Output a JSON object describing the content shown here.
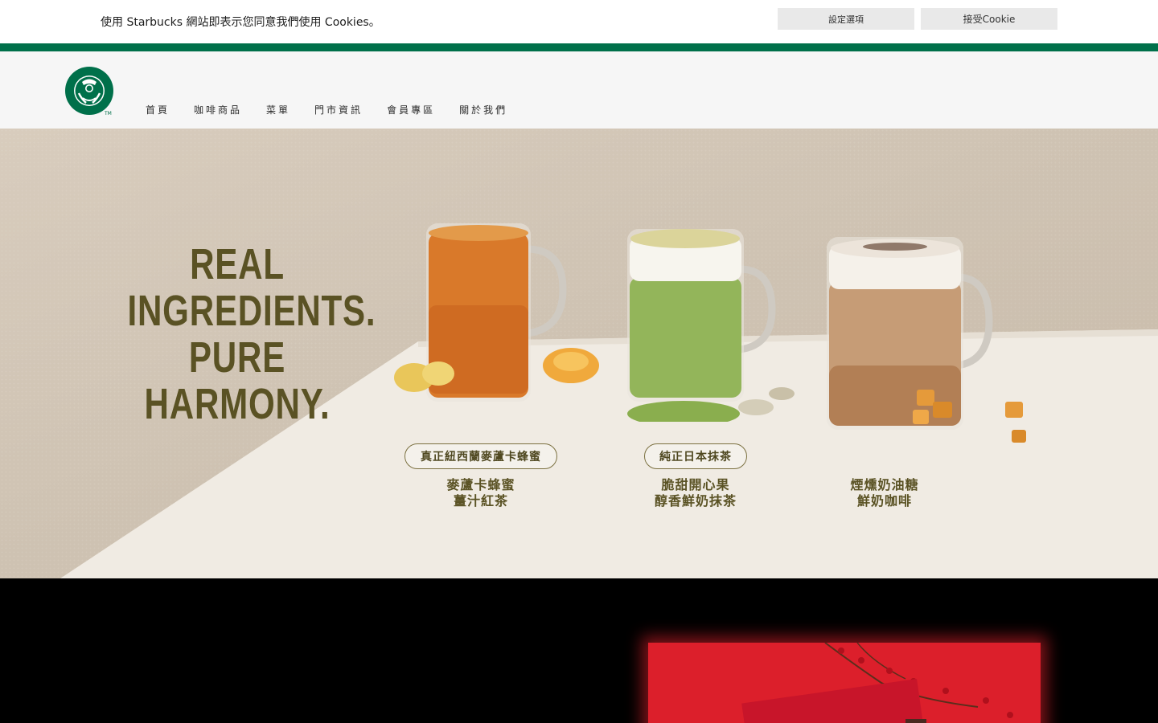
{
  "cookie_bar": {
    "message": "使用 Starbucks 網站即表示您同意我們使用 Cookies。",
    "settings_button": "設定選項",
    "accept_button": "接受Cookie"
  },
  "header": {
    "logo_alt": "Starbucks",
    "nav": [
      {
        "label": "首頁"
      },
      {
        "label": "咖啡商品"
      },
      {
        "label": "菜單"
      },
      {
        "label": "門市資訊"
      },
      {
        "label": "會員專區"
      },
      {
        "label": "關於我們"
      }
    ]
  },
  "hero": {
    "headline": [
      "REAL",
      "INGREDIENTS.",
      "PURE",
      "HARMONY."
    ],
    "drinks": [
      {
        "badge": "真正紐西蘭麥蘆卡蜂蜜",
        "name_line1": "麥蘆卡蜂蜜",
        "name_line2": "薑汁紅茶"
      },
      {
        "badge": "純正日本抹茶",
        "name_line1": "脆甜開心果",
        "name_line2": "醇香鮮奶抹茶"
      },
      {
        "badge": "",
        "name_line1": "煙燻奶油糖",
        "name_line2": "鮮奶咖啡"
      }
    ]
  },
  "colors": {
    "brand_green": "#00704a",
    "headline_olive": "#5a5224",
    "promo_red": "#e0202c"
  }
}
